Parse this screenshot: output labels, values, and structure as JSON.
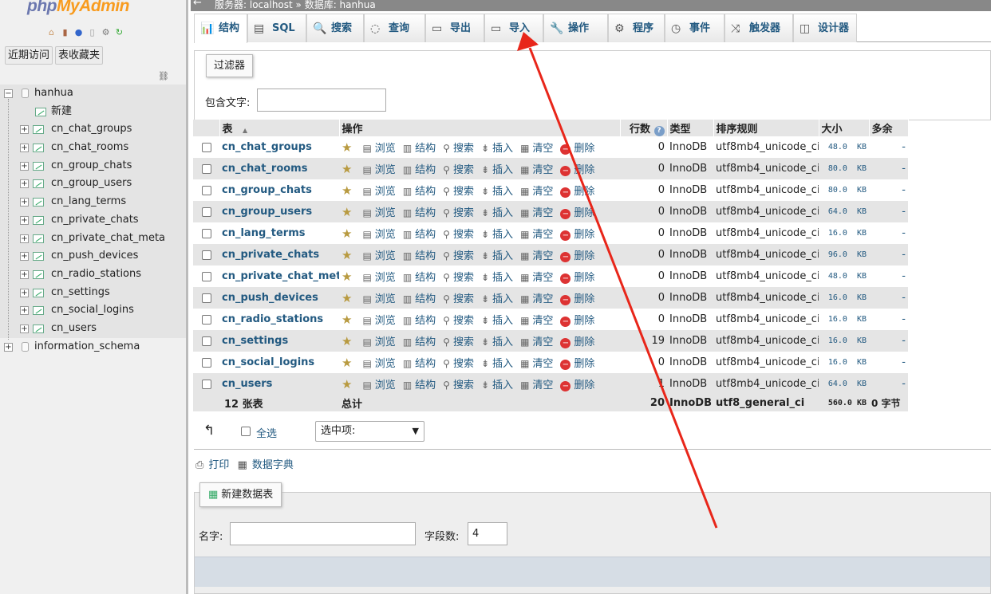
{
  "logo": {
    "php": "php",
    "myadmin": "MyAdmin"
  },
  "nav_icons": [
    "home-icon",
    "exit-icon",
    "help-icon",
    "docs-icon",
    "settings-icon",
    "reload-icon"
  ],
  "nav_buttons": {
    "recent": "近期访问",
    "favorites": "表收藏夹"
  },
  "tree": {
    "db": "hanhua",
    "new": "新建",
    "tables": [
      "cn_chat_groups",
      "cn_chat_rooms",
      "cn_group_chats",
      "cn_group_users",
      "cn_lang_terms",
      "cn_private_chats",
      "cn_private_chat_meta",
      "cn_push_devices",
      "cn_radio_stations",
      "cn_settings",
      "cn_social_logins",
      "cn_users"
    ],
    "other_db": "information_schema"
  },
  "breadcrumb": {
    "back": "←",
    "text": "服务器: localhost » 数据库: hanhua"
  },
  "tabs": [
    {
      "label": "结构",
      "icon": "structure-icon",
      "glyph": "📊"
    },
    {
      "label": "SQL",
      "icon": "sql-icon",
      "glyph": "▤"
    },
    {
      "label": "搜索",
      "icon": "search-icon",
      "glyph": "🔍"
    },
    {
      "label": "查询",
      "icon": "query-icon",
      "glyph": "◌"
    },
    {
      "label": "导出",
      "icon": "export-icon",
      "glyph": "▭"
    },
    {
      "label": "导入",
      "icon": "import-icon",
      "glyph": "▭"
    },
    {
      "label": "操作",
      "icon": "wrench-icon",
      "glyph": "🔧"
    },
    {
      "label": "程序",
      "icon": "routines-icon",
      "glyph": "⚙"
    },
    {
      "label": "事件",
      "icon": "clock-icon",
      "glyph": "◷"
    },
    {
      "label": "触发器",
      "icon": "trigger-icon",
      "glyph": "⤨"
    },
    {
      "label": "设计器",
      "icon": "designer-icon",
      "glyph": "◫"
    }
  ],
  "filter": {
    "legend": "过滤器",
    "label": "包含文字:",
    "value": ""
  },
  "table_headers": {
    "table": "表",
    "sort": "▲",
    "action": "操作",
    "rows": "行数",
    "type": "类型",
    "collation": "排序规则",
    "size": "大小",
    "overhead": "多余"
  },
  "actions": {
    "browse": "浏览",
    "structure": "结构",
    "search": "搜索",
    "insert": "插入",
    "empty": "清空",
    "drop": "删除"
  },
  "rows": [
    {
      "name": "cn_chat_groups",
      "rows": "0",
      "type": "InnoDB",
      "collation": "utf8mb4_unicode_ci",
      "size": "48.0",
      "unit": "KB",
      "overhead": "-"
    },
    {
      "name": "cn_chat_rooms",
      "rows": "0",
      "type": "InnoDB",
      "collation": "utf8mb4_unicode_ci",
      "size": "80.0",
      "unit": "KB",
      "overhead": "-"
    },
    {
      "name": "cn_group_chats",
      "rows": "0",
      "type": "InnoDB",
      "collation": "utf8mb4_unicode_ci",
      "size": "80.0",
      "unit": "KB",
      "overhead": "-"
    },
    {
      "name": "cn_group_users",
      "rows": "0",
      "type": "InnoDB",
      "collation": "utf8mb4_unicode_ci",
      "size": "64.0",
      "unit": "KB",
      "overhead": "-"
    },
    {
      "name": "cn_lang_terms",
      "rows": "0",
      "type": "InnoDB",
      "collation": "utf8mb4_unicode_ci",
      "size": "16.0",
      "unit": "KB",
      "overhead": "-"
    },
    {
      "name": "cn_private_chats",
      "rows": "0",
      "type": "InnoDB",
      "collation": "utf8mb4_unicode_ci",
      "size": "96.0",
      "unit": "KB",
      "overhead": "-"
    },
    {
      "name": "cn_private_chat_meta",
      "rows": "0",
      "type": "InnoDB",
      "collation": "utf8mb4_unicode_ci",
      "size": "48.0",
      "unit": "KB",
      "overhead": "-"
    },
    {
      "name": "cn_push_devices",
      "rows": "0",
      "type": "InnoDB",
      "collation": "utf8mb4_unicode_ci",
      "size": "16.0",
      "unit": "KB",
      "overhead": "-"
    },
    {
      "name": "cn_radio_stations",
      "rows": "0",
      "type": "InnoDB",
      "collation": "utf8mb4_unicode_ci",
      "size": "16.0",
      "unit": "KB",
      "overhead": "-"
    },
    {
      "name": "cn_settings",
      "rows": "19",
      "type": "InnoDB",
      "collation": "utf8mb4_unicode_ci",
      "size": "16.0",
      "unit": "KB",
      "overhead": "-"
    },
    {
      "name": "cn_social_logins",
      "rows": "0",
      "type": "InnoDB",
      "collation": "utf8mb4_unicode_ci",
      "size": "16.0",
      "unit": "KB",
      "overhead": "-"
    },
    {
      "name": "cn_users",
      "rows": "1",
      "type": "InnoDB",
      "collation": "utf8mb4_unicode_ci",
      "size": "64.0",
      "unit": "KB",
      "overhead": "-"
    }
  ],
  "totals": {
    "count": "12 张表",
    "label": "总计",
    "rows": "20",
    "type": "InnoDB",
    "collation": "utf8_general_ci",
    "size": "560.0",
    "unit": "KB",
    "overhead": "0 字节"
  },
  "bulk": {
    "arrow": "↰",
    "check_all": "全选",
    "with_selected": "选中项:"
  },
  "links": {
    "print": "打印",
    "dictionary": "数据字典"
  },
  "create": {
    "legend": "新建数据表",
    "name_label": "名字:",
    "name_value": "",
    "cols_label": "字段数:",
    "cols_value": "4"
  },
  "annotation": {
    "color": "#e8261a"
  }
}
